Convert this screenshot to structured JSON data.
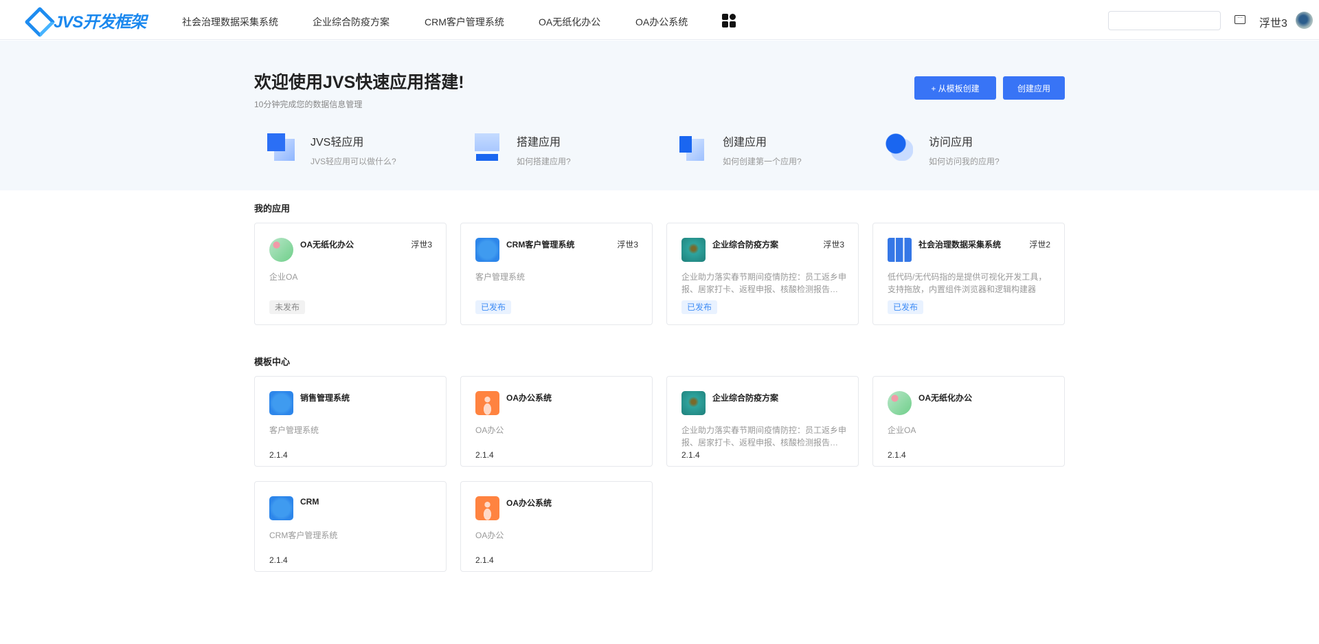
{
  "header": {
    "logo_text": "JVS开发框架",
    "nav": [
      "社会治理数据采集系统",
      "企业综合防疫方案",
      "CRM客户管理系统",
      "OA无纸化办公",
      "OA办公系统"
    ],
    "search_placeholder": "",
    "user_name": "浮世3",
    "icons": [
      "apps-grid-icon",
      "message-icon"
    ]
  },
  "hero": {
    "title": "欢迎使用JVS快速应用搭建!",
    "subtitle": "10分钟完成您的数据信息管理",
    "btn_template": "+ 从模板创建",
    "btn_create": "创建应用",
    "accent": "#3874f6",
    "quick": [
      {
        "title": "JVS轻应用",
        "desc": "JVS轻应用可以做什么?"
      },
      {
        "title": "搭建应用",
        "desc": "如何搭建应用?"
      },
      {
        "title": "创建应用",
        "desc": "如何创建第一个应用?"
      },
      {
        "title": "访问应用",
        "desc": "如何访问我的应用?"
      }
    ]
  },
  "my_apps": {
    "title": "我的应用",
    "items": [
      {
        "name": "OA无纸化办公",
        "author": "浮世3",
        "desc": "企业OA",
        "status": "未发布"
      },
      {
        "name": "CRM客户管理系统",
        "author": "浮世3",
        "desc": "客户管理系统",
        "status": "已发布"
      },
      {
        "name": "企业综合防疫方案",
        "author": "浮世3",
        "desc": "企业助力落实春节期间疫情防控：员工返乡申报、居家打卡、返程申报、核酸检测报告上传等",
        "status": "已发布"
      },
      {
        "name": "社会治理数据采集系统",
        "author": "浮世2",
        "desc": "低代码/无代码指的是提供可视化开发工具，支持拖放，内置组件浏览器和逻辑构建器",
        "status": "已发布"
      }
    ]
  },
  "templates": {
    "title": "模板中心",
    "items": [
      {
        "name": "销售管理系统",
        "desc": "客户管理系统",
        "version": "2.1.4"
      },
      {
        "name": "OA办公系统",
        "desc": "OA办公",
        "version": "2.1.4"
      },
      {
        "name": "企业综合防疫方案",
        "desc": "企业助力落实春节期间疫情防控：员工返乡申报、居家打卡、返程申报、核酸检测报告上传等",
        "version": "2.1.4"
      },
      {
        "name": "OA无纸化办公",
        "desc": "企业OA",
        "version": "2.1.4"
      },
      {
        "name": "CRM",
        "desc": "CRM客户管理系统",
        "version": "2.1.4"
      },
      {
        "name": "OA办公系统",
        "desc": "OA办公",
        "version": "2.1.4"
      }
    ]
  }
}
